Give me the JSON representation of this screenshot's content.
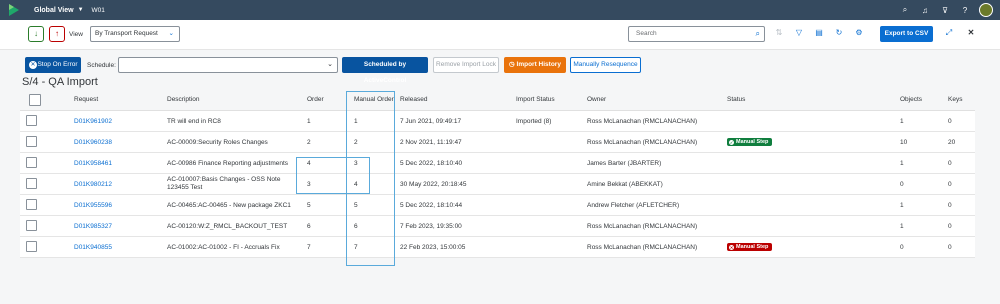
{
  "shell": {
    "app_title": "Global View",
    "system": "W01",
    "icons": [
      "search-icon",
      "bell-icon",
      "filter-off-icon",
      "help-icon"
    ]
  },
  "toolbar": {
    "view_label": "View",
    "view_value": "By Transport Request",
    "search_placeholder": "Search",
    "export_label": "Export to CSV"
  },
  "actionbar": {
    "stop_on_error": "Stop On Error",
    "schedule_label": "Schedule:",
    "schedule_value": "",
    "scheduled_by": "Scheduled by ActiveControl",
    "remove_lock": "Remove Import Lock",
    "import_history": "Import History",
    "manual_resequence": "Manually Resequence"
  },
  "page": {
    "title": "S/4 - QA Import"
  },
  "table": {
    "columns": {
      "request": "Request",
      "description": "Description",
      "order": "Order",
      "manual_order": "Manual Order",
      "released": "Released",
      "import_status": "Import Status",
      "owner": "Owner",
      "status": "Status",
      "objects": "Objects",
      "keys": "Keys"
    },
    "rows": [
      {
        "request": "D01K961902",
        "description": "TR will end in RC8",
        "order": "1",
        "manual_order": "1",
        "released": "7 Jun 2021, 09:49:17",
        "import_status": "Imported (8)",
        "owner": "Ross McLanachan (RMCLANACHAN)",
        "status": "",
        "objects": "1",
        "keys": "0"
      },
      {
        "request": "D01K960238",
        "description": "AC-00009:Security Roles Changes",
        "order": "2",
        "manual_order": "2",
        "released": "2 Nov 2021, 11:19:47",
        "import_status": "",
        "owner": "Ross McLanachan (RMCLANACHAN)",
        "status": "Manual Step",
        "objects": "10",
        "keys": "20"
      },
      {
        "request": "D01K958461",
        "description": "AC-00986 Finance Reporting adjustments",
        "order": "4",
        "manual_order": "3",
        "released": "5 Dec 2022, 18:10:40",
        "import_status": "",
        "owner": "James Barter (JBARTER)",
        "status": "",
        "objects": "1",
        "keys": "0"
      },
      {
        "request": "D01K980212",
        "description": "AC-010007:Basis Changes - OSS Note 123455 Test",
        "order": "3",
        "manual_order": "4",
        "released": "30 May 2022, 20:18:45",
        "import_status": "",
        "owner": "Amine Bekkat (ABEKKAT)",
        "status": "",
        "objects": "0",
        "keys": "0"
      },
      {
        "request": "D01K955596",
        "description": "AC-00465:AC-00465 - New package ZKC1",
        "order": "5",
        "manual_order": "5",
        "released": "5 Dec 2022, 18:10:44",
        "import_status": "",
        "owner": "Andrew Fletcher (AFLETCHER)",
        "status": "",
        "objects": "1",
        "keys": "0"
      },
      {
        "request": "D01K985327",
        "description": "AC-00120:W:Z_RMCL_BACKOUT_TEST",
        "order": "6",
        "manual_order": "6",
        "released": "7 Feb 2023, 19:35:00",
        "import_status": "",
        "owner": "Ross McLanachan (RMCLANACHAN)",
        "status": "",
        "objects": "1",
        "keys": "0"
      },
      {
        "request": "D01K940855",
        "description": "AC-01002:AC-01002 - FI - Accruals Fix",
        "order": "7",
        "manual_order": "7",
        "released": "22 Feb 2023, 15:00:05",
        "import_status": "",
        "owner": "Ross McLanachan (RMCLANACHAN)",
        "status": "Manual Step",
        "objects": "0",
        "keys": "0"
      }
    ]
  },
  "colors": {
    "shell": "#354a5f",
    "brand_blue": "#0a6ed1",
    "history_orange": "#e9730c",
    "manual_step_green": "#107e3e",
    "manual_step_red": "#bb0000",
    "highlight": "#5aaadb"
  }
}
